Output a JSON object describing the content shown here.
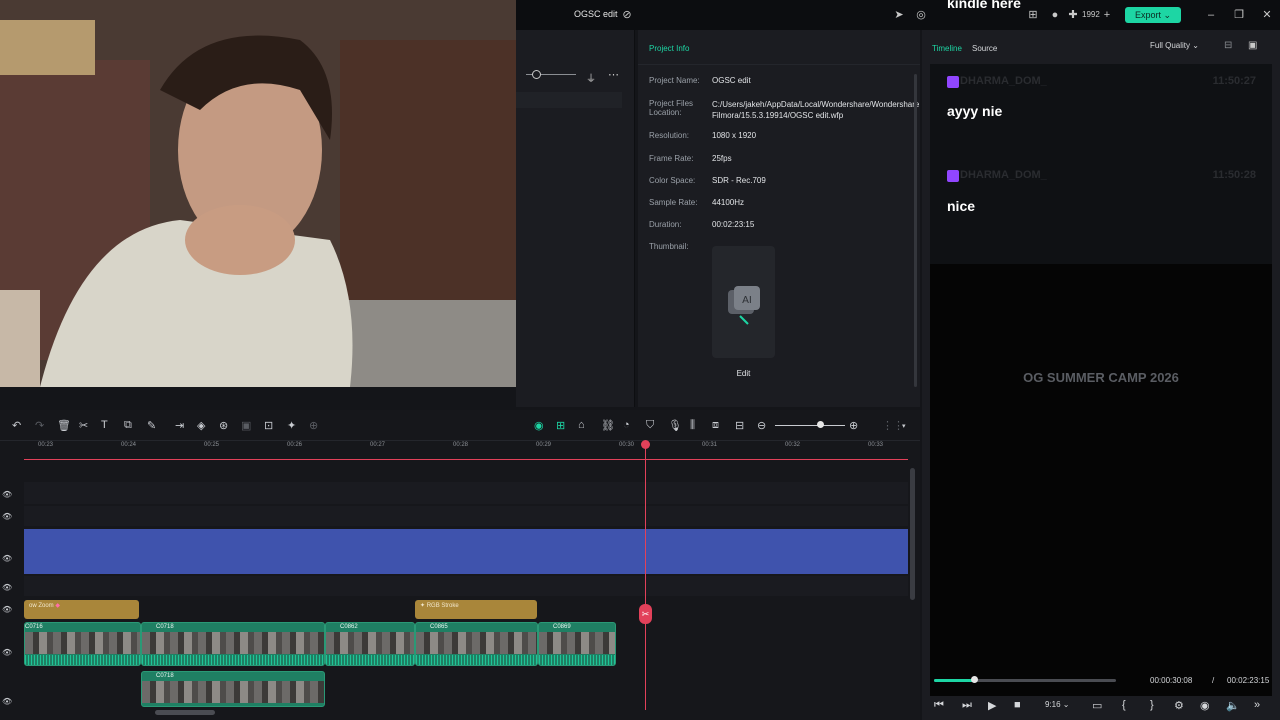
{
  "window": {
    "title": "OGSC edit",
    "credits": "1992",
    "export_label": "Export"
  },
  "overlay": {
    "text": "kindle here"
  },
  "project_info": {
    "tab_label": "Project Info",
    "rows": [
      {
        "label": "Project Name:",
        "value": "OGSC edit"
      },
      {
        "label": "Project Files Location:",
        "value": "C:/Users/jakeh/AppData/Local/Wondershare/Wondershare Filmora/15.5.3.19914/OGSC edit.wfp"
      },
      {
        "label": "Resolution:",
        "value": "1080 x 1920"
      },
      {
        "label": "Frame Rate:",
        "value": "25fps"
      },
      {
        "label": "Color Space:",
        "value": "SDR - Rec.709"
      },
      {
        "label": "Sample Rate:",
        "value": "44100Hz"
      },
      {
        "label": "Duration:",
        "value": "00:02:23:15"
      }
    ],
    "thumbnail_label": "Thumbnail:",
    "edit_label": "Edit"
  },
  "preview": {
    "tabs": [
      "Timeline",
      "Source"
    ],
    "quality": "Full Quality",
    "chat": [
      {
        "user": "DHARMA_DOM_",
        "time": "11:50:27",
        "message": "ayyy nie"
      },
      {
        "user": "DHARMA_DOM_",
        "time": "11:50:28",
        "message": "nice"
      }
    ],
    "overlay_title": "OG SUMMER CAMP 2026",
    "progress": 0.22,
    "current_time": "00:00:30:08",
    "separator": "/",
    "duration": "00:02:23:15",
    "ratio": "9:16"
  },
  "timeline": {
    "ruler_labels": [
      "00:23",
      "00:24",
      "00:25",
      "00:26",
      "00:27",
      "00:28",
      "00:29",
      "00:30",
      "00:31",
      "00:32",
      "00:33"
    ],
    "effect_clips": [
      {
        "label": "ow Zoom"
      },
      {
        "label": "RGB Stroke"
      }
    ],
    "video_clips": [
      {
        "label": "C0716"
      },
      {
        "label": "C0718"
      },
      {
        "label": "C0862"
      },
      {
        "label": "C0865"
      },
      {
        "label": "C0869"
      },
      {
        "label": "C0718"
      }
    ]
  },
  "colors": {
    "accent": "#1dd6a4",
    "playhead": "#e2415a",
    "blue_clip": "#3f53ad",
    "effect_clip": "#a9863a",
    "video_clip": "#1f7f63"
  }
}
